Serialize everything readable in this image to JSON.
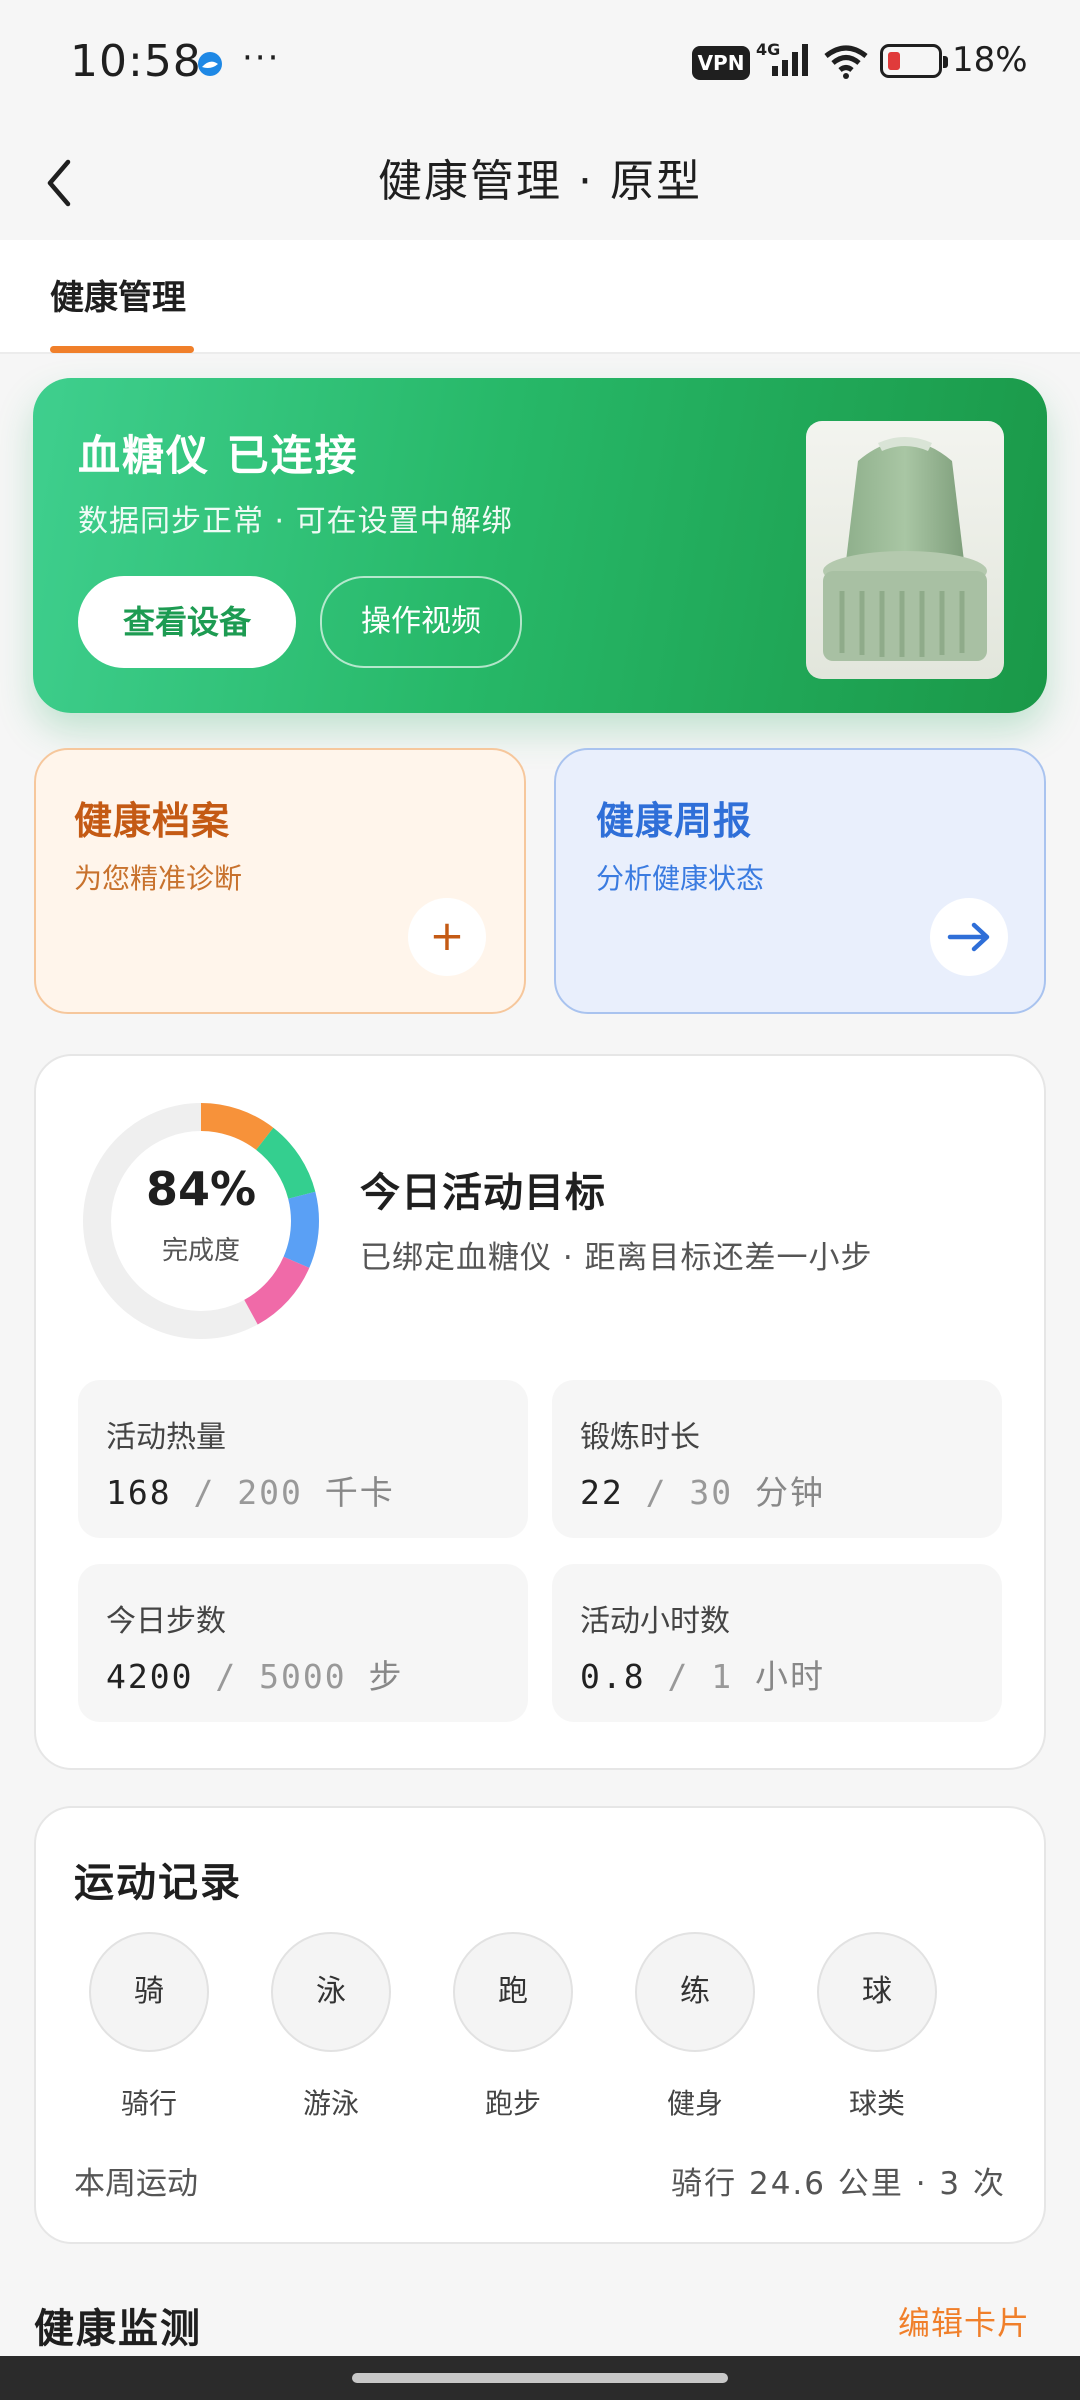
{
  "status": {
    "time": "10:58",
    "dots": "···",
    "vpn": "VPN",
    "network": "4G",
    "battery": "18%"
  },
  "header": {
    "title": "健康管理 · 原型",
    "tab": "健康管理"
  },
  "device": {
    "title": "血糖仪 已连接",
    "subtitle": "数据同步正常 · 可在设置中解绑",
    "view_button": "查看设备",
    "video_button": "操作视频"
  },
  "quick_cards": {
    "record": {
      "title": "健康档案",
      "subtitle": "为您精准诊断",
      "action": "+"
    },
    "report": {
      "title": "健康周报",
      "subtitle": "分析健康状态"
    }
  },
  "activity": {
    "percent": "84%",
    "percent_label": "完成度",
    "completion": 0.84,
    "title": "今日活动目标",
    "subtitle": "已绑定血糖仪 · 距离目标还差一小步",
    "metrics": [
      {
        "label": "活动热量",
        "value": "168",
        "sep": "/",
        "target": "200",
        "unit": "千卡"
      },
      {
        "label": "锻炼时长",
        "value": "22",
        "sep": "/",
        "target": "30",
        "unit": "分钟"
      },
      {
        "label": "今日步数",
        "value": "4200",
        "sep": "/",
        "target": "5000",
        "unit": "步"
      },
      {
        "label": "活动小时数",
        "value": "0.8",
        "sep": "/",
        "target": "1",
        "unit": "小时"
      }
    ],
    "ring_colors": [
      "#f7923a",
      "#34cf8f",
      "#5aa0f5",
      "#f06aa8"
    ]
  },
  "exercise": {
    "title": "运动记录",
    "sports": [
      {
        "icon": "骑",
        "label": "骑行"
      },
      {
        "icon": "泳",
        "label": "游泳"
      },
      {
        "icon": "跑",
        "label": "跑步"
      },
      {
        "icon": "练",
        "label": "健身"
      },
      {
        "icon": "球",
        "label": "球类"
      }
    ],
    "week_label": "本周运动",
    "week_value": "骑行 24.6 公里 · 3 次"
  },
  "monitor": {
    "title": "健康监测",
    "edit": "编辑卡片"
  }
}
